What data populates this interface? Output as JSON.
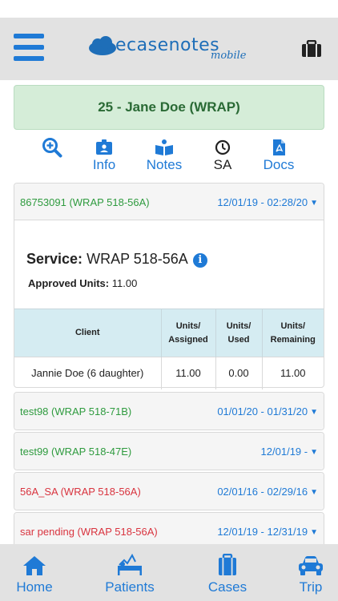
{
  "app": {
    "logo_main": "ecasenotes",
    "logo_sub": "mobile"
  },
  "patient": {
    "banner": "25 - Jane Doe (WRAP)"
  },
  "tabs": [
    {
      "label": "",
      "icon": "search-plus-icon"
    },
    {
      "label": "Info",
      "icon": "id-card-icon"
    },
    {
      "label": "Notes",
      "icon": "book-icon"
    },
    {
      "label": "SA",
      "icon": "clock-icon"
    },
    {
      "label": "Docs",
      "icon": "pdf-file-icon"
    }
  ],
  "authorizations": [
    {
      "name": "86753091 (WRAP 518-56A)",
      "dates": "12/01/19 - 02:28/20",
      "status_color": "green"
    },
    {
      "name": "test98 (WRAP 518-71B)",
      "dates": "01/01/20 - 01/31/20",
      "status_color": "green"
    },
    {
      "name": "test99 (WRAP 518-47E)",
      "dates": "12/01/19 -",
      "status_color": "green"
    },
    {
      "name": "56A_SA (WRAP 518-56A)",
      "dates": "02/01/16 - 02/29/16",
      "status_color": "red"
    },
    {
      "name": "sar pending (WRAP 518-56A)",
      "dates": "12/01/19 - 12/31/19",
      "status_color": "red"
    }
  ],
  "service_detail": {
    "service_label": "Service:",
    "service_value": "WRAP 518-56A",
    "approved_label": "Approved Units:",
    "approved_value": "11.00",
    "table": {
      "headers": {
        "client": "Client",
        "assigned_1": "Units/",
        "assigned_2": "Assigned",
        "used_1": "Units/",
        "used_2": "Used",
        "remaining_1": "Units/",
        "remaining_2": "Remaining"
      },
      "row": {
        "client": "Jannie Doe (6 daughter)",
        "assigned": "11.00",
        "used": "0.00",
        "remaining": "11.00"
      }
    }
  },
  "bottom_nav": [
    {
      "label": "Home",
      "icon": "home-icon"
    },
    {
      "label": "Patients",
      "icon": "patient-bed-icon"
    },
    {
      "label": "Cases",
      "icon": "briefcase-icon"
    },
    {
      "label": "Trip",
      "icon": "car-icon"
    }
  ],
  "colors": {
    "accent": "#1f7ad6",
    "header_bg": "#e2e2e2",
    "banner_bg": "#d5edd8",
    "green_text": "#2f9b3f",
    "red_text": "#d9343f",
    "table_head_bg": "#d5ecf2"
  }
}
